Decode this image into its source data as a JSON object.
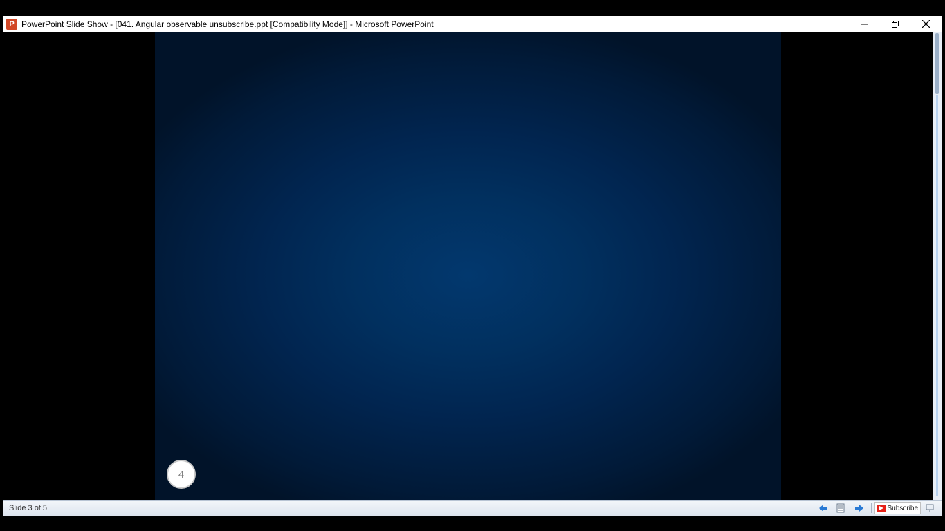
{
  "window": {
    "app_icon_letter": "P",
    "title": "PowerPoint Slide Show - [041. Angular observable unsubscribe.ppt [Compatibility Mode]] - Microsoft PowerPoint"
  },
  "window_controls": {
    "icons": [
      "minimize-icon",
      "restore-icon",
      "close-icon"
    ]
  },
  "slide": {
    "number_badge": "4",
    "colors": {
      "center": "#02386e",
      "edge": "#011329"
    }
  },
  "statusbar": {
    "slide_indicator": "Slide 3 of 5",
    "subscribe_label": "Subscribe",
    "icons": [
      "previous-slide-icon",
      "slide-menu-icon",
      "next-slide-icon",
      "subscribe-icon",
      "view-menu-icon"
    ]
  },
  "colors": {
    "accent_blue": "#2a7ad4",
    "youtube_red": "#e62117"
  }
}
